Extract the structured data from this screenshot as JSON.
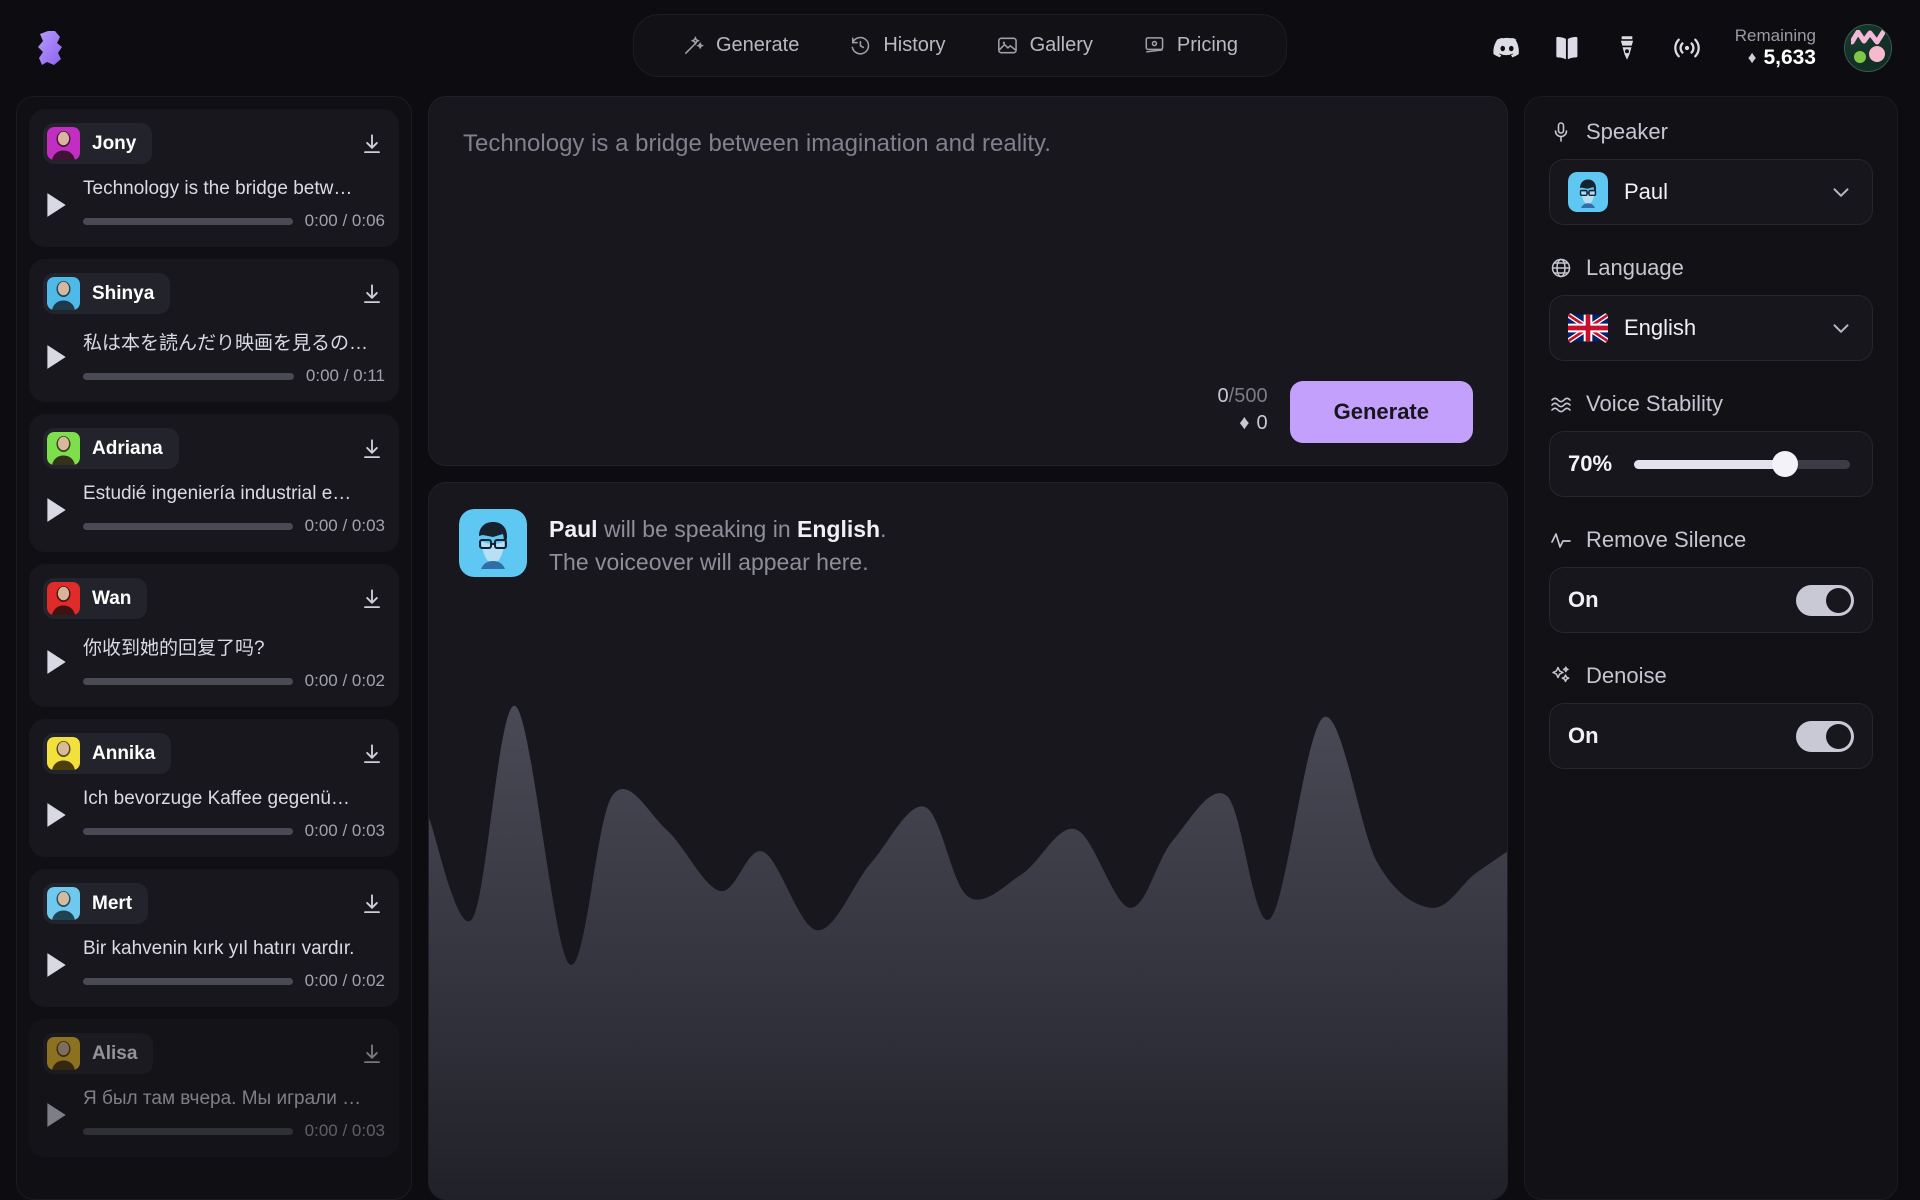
{
  "brand": {
    "logo_icon": "puzzle-s-logo",
    "accent": "#a98bf5"
  },
  "nav": {
    "items": [
      {
        "label": "Generate",
        "icon": "magic-wand-icon"
      },
      {
        "label": "History",
        "icon": "clock-history-icon"
      },
      {
        "label": "Gallery",
        "icon": "image-icon"
      },
      {
        "label": "Pricing",
        "icon": "pricing-card-icon"
      }
    ]
  },
  "header_right": {
    "icons": [
      {
        "name": "discord-icon"
      },
      {
        "name": "book-icon"
      },
      {
        "name": "pen-nib-icon"
      },
      {
        "name": "broadcast-icon"
      }
    ],
    "credits_label": "Remaining",
    "credits_diamond": "♦",
    "credits_value": "5,633",
    "avatar_name": "user-avatar"
  },
  "sidebar": {
    "cards": [
      {
        "name": "Jony",
        "text": "Technology is the bridge betw…",
        "current": "0:00",
        "duration": "0:06",
        "thumb": "#c22ec2",
        "faded": false
      },
      {
        "name": "Shinya",
        "text": "私は本を読んだり映画を見るの…",
        "current": "0:00",
        "duration": "0:11",
        "thumb": "#4fb9e8",
        "faded": false
      },
      {
        "name": "Adriana",
        "text": "Estudié ingeniería industrial e…",
        "current": "0:00",
        "duration": "0:03",
        "thumb": "#7ddf4c",
        "faded": false
      },
      {
        "name": "Wan",
        "text": "你收到她的回复了吗?",
        "current": "0:00",
        "duration": "0:02",
        "thumb": "#e02b2b",
        "faded": false
      },
      {
        "name": "Annika",
        "text": "Ich bevorzuge Kaffee gegenü…",
        "current": "0:00",
        "duration": "0:03",
        "thumb": "#f2e13c",
        "faded": false
      },
      {
        "name": "Mert",
        "text": "Bir kahvenin kırk yıl hatırı vardır.",
        "current": "0:00",
        "duration": "0:02",
        "thumb": "#6fc9ee",
        "faded": false
      },
      {
        "name": "Alisa",
        "text": "Я был там вчера. Мы играли …",
        "current": "0:00",
        "duration": "0:03",
        "thumb": "#f2c32a",
        "faded": true
      }
    ],
    "download_icon": "download-icon",
    "play_icon": "play-icon"
  },
  "editor": {
    "placeholder": "Technology is a bridge between imagination and reality.",
    "char_count": "0",
    "char_sep": "/",
    "char_max": "500",
    "cost_diamond": "♦",
    "cost_value": "0",
    "generate_label": "Generate"
  },
  "preview": {
    "speaker": "Paul",
    "mid_text": " will be speaking in ",
    "language": "English",
    "period": ".",
    "subtitle": "The voiceover will appear here."
  },
  "settings": {
    "speaker": {
      "label": "Speaker",
      "icon": "microphone-icon",
      "value": "Paul",
      "chevron": "chevron-down-icon"
    },
    "language": {
      "label": "Language",
      "icon": "globe-icon",
      "value": "English",
      "flag": "uk-flag",
      "chevron": "chevron-down-icon"
    },
    "voice_stability": {
      "label": "Voice Stability",
      "icon": "waves-icon",
      "value": "70%",
      "percent": 70
    },
    "remove_silence": {
      "label": "Remove Silence",
      "icon": "pulse-icon",
      "value": "On",
      "enabled": true
    },
    "denoise": {
      "label": "Denoise",
      "icon": "sparkles-icon",
      "value": "On",
      "enabled": true
    }
  },
  "chart_data": {
    "type": "area",
    "title": "Voice waveform preview",
    "xlabel": "",
    "ylabel": "",
    "x": [
      0,
      4,
      8,
      13,
      17,
      22,
      27,
      31,
      36,
      41,
      46,
      50,
      55,
      60,
      65,
      69,
      74,
      78,
      83,
      88,
      93,
      97,
      100
    ],
    "values": [
      68,
      50,
      88,
      42,
      72,
      66,
      55,
      62,
      48,
      60,
      70,
      54,
      58,
      66,
      52,
      64,
      72,
      50,
      86,
      60,
      52,
      58,
      62
    ],
    "ylim": [
      0,
      100
    ],
    "grid": false,
    "legend": "none"
  }
}
